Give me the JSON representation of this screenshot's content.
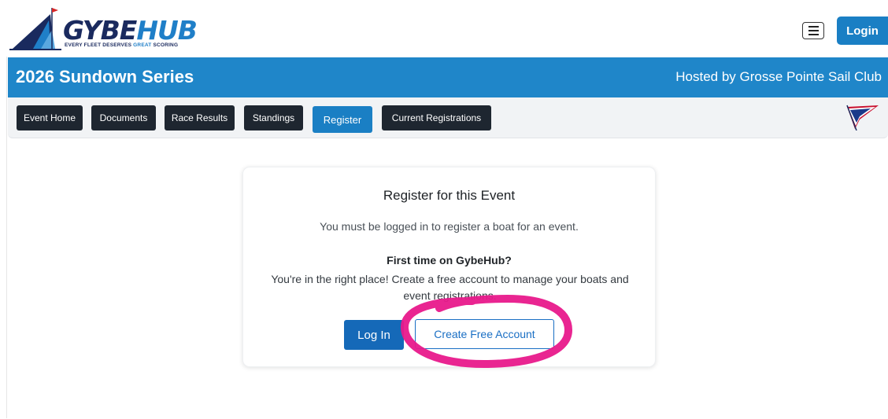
{
  "brand": {
    "name_part1": "GYBE",
    "name_part2": "HUB",
    "tagline_part1": "EVERY FLEET DESERVES ",
    "tagline_great": "GREAT",
    "tagline_part2": " SCORING",
    "logo_icon": "sailboat-icon"
  },
  "header": {
    "menu_icon": "hamburger-menu-icon",
    "login_label": "Login"
  },
  "banner": {
    "title": "2026 Sundown Series",
    "host": "Hosted by Grosse Pointe Sail Club"
  },
  "nav": {
    "items": [
      {
        "label": "Event Home",
        "active": false
      },
      {
        "label": "Documents",
        "active": false
      },
      {
        "label": "Race Results",
        "active": false
      },
      {
        "label": "Standings",
        "active": false
      },
      {
        "label": "Register",
        "active": true
      },
      {
        "label": "Current Registrations",
        "active": false
      }
    ],
    "club_icon": "club-burgee-icon"
  },
  "register_card": {
    "title": "Register for this Event",
    "note": "You must be logged in to register a boat for an event.",
    "subheading": "First time on GybeHub?",
    "body": "You're in the right place! Create a free account to manage your boats and event registrations.",
    "login_button": "Log In",
    "create_button": "Create Free Account"
  },
  "colors": {
    "primary": "#1f86c9",
    "nav_dark": "#1e2630",
    "annotation": "#e8198b"
  }
}
